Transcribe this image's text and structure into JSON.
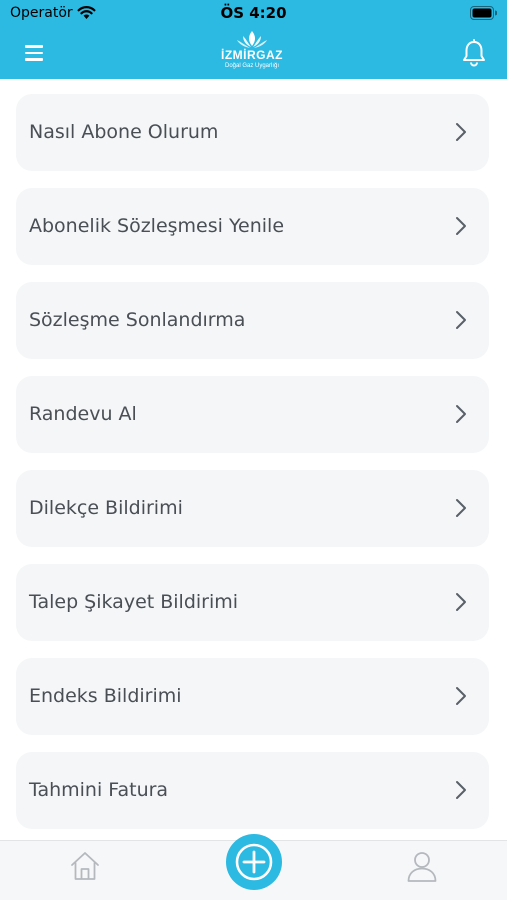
{
  "status_bar": {
    "carrier": "Operatör",
    "time": "ÖS 4:20"
  },
  "header": {
    "logo_text": "İZMİRGAZ",
    "logo_subtitle": "Doğal Gaz Uygarlığı",
    "menu_icon": "hamburger-menu-icon",
    "notification_icon": "bell-icon"
  },
  "menu_items": [
    {
      "label": "Nasıl Abone Olurum"
    },
    {
      "label": "Abonelik Sözleşmesi Yenile"
    },
    {
      "label": "Sözleşme Sonlandırma"
    },
    {
      "label": "Randevu Al"
    },
    {
      "label": "Dilekçe Bildirimi"
    },
    {
      "label": "Talep Şikayet Bildirimi"
    },
    {
      "label": "Endeks Bildirimi"
    },
    {
      "label": "Tahmini Fatura"
    }
  ],
  "tab_bar": {
    "home_icon": "home-icon",
    "add_icon": "plus-circle-icon",
    "profile_icon": "user-icon"
  },
  "colors": {
    "accent": "#2cb9e2",
    "card_background": "#f4f6f8",
    "text": "#4a4f55"
  }
}
